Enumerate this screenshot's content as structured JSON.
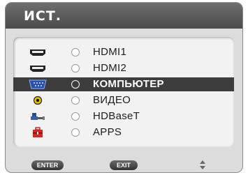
{
  "menu": {
    "title": "ИСТ.",
    "items": [
      {
        "label": "HDMI1",
        "icon": "hdmi-icon",
        "selected": false
      },
      {
        "label": "HDMI2",
        "icon": "hdmi-icon",
        "selected": false
      },
      {
        "label": "КОМПЬЮТЕР",
        "icon": "computer-vga-icon",
        "selected": true
      },
      {
        "label": "ВИДЕО",
        "icon": "video-rca-icon",
        "selected": false
      },
      {
        "label": "HDBaseT",
        "icon": "hdbaset-network-icon",
        "selected": false
      },
      {
        "label": "APPS",
        "icon": "apps-toolbox-icon",
        "selected": false
      }
    ]
  },
  "footer": {
    "enter_label": "ENTER",
    "exit_label": "EXIT",
    "updown_icon": "up-down-arrows-icon"
  },
  "colors": {
    "title_bar": "#5a5a5a",
    "selection": "#3d3d3d",
    "panel": "#f2f2f2",
    "frame": "#dcdcdc"
  }
}
